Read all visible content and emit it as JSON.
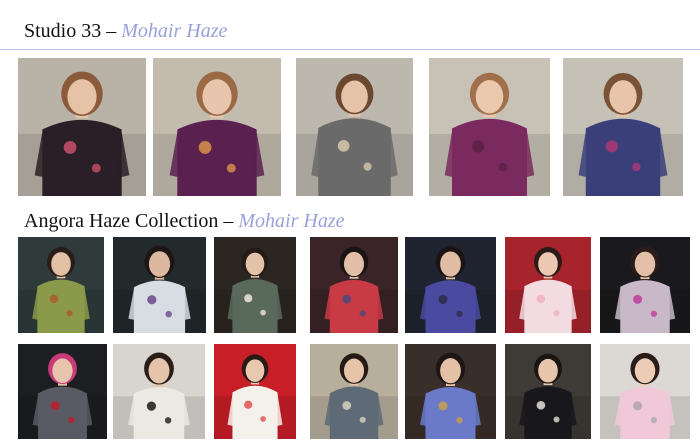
{
  "studio_section": {
    "name": "Studio 33",
    "dash": "–",
    "brand": "Mohair Haze",
    "photos": [
      {
        "bg": "#b9b2a6",
        "garment": "#2a1f26",
        "accent": "#c8506a",
        "skin": "#e6c2a6",
        "hair": "#8a5a3a",
        "icon": "model-photo"
      },
      {
        "bg": "#c3bcae",
        "garment": "#5a2050",
        "accent": "#d9934a",
        "skin": "#e8c6ae",
        "hair": "#9a6a44",
        "icon": "model-photo"
      },
      {
        "bg": "#bdb8ae",
        "garment": "#6b6a6a",
        "accent": "#d7c7ac",
        "skin": "#e6c3a8",
        "hair": "#6c4830",
        "icon": "model-photo"
      },
      {
        "bg": "#c8c2b6",
        "garment": "#7a2a5e",
        "accent": "#5a2044",
        "skin": "#eac8ae",
        "hair": "#a0704a",
        "icon": "model-photo"
      },
      {
        "bg": "#c6c1b7",
        "garment": "#3a3f7a",
        "accent": "#b03878",
        "skin": "#e8c4aa",
        "hair": "#7a5236",
        "icon": "model-photo"
      }
    ]
  },
  "angora_section": {
    "name": "Angora Haze Collection",
    "dash": "–",
    "brand": "Mohair Haze",
    "photos_row1": [
      {
        "bg": "#2e3b3a",
        "garment": "#8a9a4a",
        "accent": "#a85a30",
        "skin": "#e2c0a6",
        "hair": "#2a1c18",
        "icon": "model-photo"
      },
      {
        "bg": "#222a2c",
        "garment": "#d8dde4",
        "accent": "#6a4a8a",
        "skin": "#dcb8a0",
        "hair": "#1e1614",
        "icon": "model-photo"
      },
      {
        "bg": "#2c2622",
        "garment": "#5a6a5a",
        "accent": "#efe6da",
        "skin": "#e4c2a8",
        "hair": "#241a16",
        "icon": "model-photo"
      },
      {
        "bg": "#3a2428",
        "garment": "#c83a44",
        "accent": "#4a4a7a",
        "skin": "#e2bea6",
        "hair": "#1a1414",
        "icon": "model-photo"
      },
      {
        "bg": "#1f2430",
        "garment": "#4a4aa0",
        "accent": "#2c2c4a",
        "skin": "#e0bca4",
        "hair": "#1c1414",
        "icon": "model-photo"
      },
      {
        "bg": "#a8242c",
        "garment": "#f2dce2",
        "accent": "#f0b0c0",
        "skin": "#ecc8b2",
        "hair": "#2a1a18",
        "icon": "model-photo"
      },
      {
        "bg": "#1a1a1e",
        "garment": "#c8b8c8",
        "accent": "#c03a9a",
        "skin": "#e4c0a8",
        "hair": "#2a1c18",
        "icon": "model-photo"
      }
    ],
    "photos_row2": [
      {
        "bg": "#1c1e22",
        "garment": "#5a5a64",
        "accent": "#c01c2c",
        "skin": "#e8c4ac",
        "hair": "#c83a78",
        "icon": "model-photo"
      },
      {
        "bg": "#d8d4ce",
        "garment": "#ece8e2",
        "accent": "#1a1a1a",
        "skin": "#e6c4ac",
        "hair": "#2a1c18",
        "icon": "model-photo"
      },
      {
        "bg": "#c81e28",
        "garment": "#f4f0ea",
        "accent": "#e05050",
        "skin": "#eac8b0",
        "hair": "#2a1a16",
        "icon": "model-photo"
      },
      {
        "bg": "#b7ae9c",
        "garment": "#5e6a76",
        "accent": "#d8cfbf",
        "skin": "#e6c4aa",
        "hair": "#241a16",
        "icon": "model-photo"
      },
      {
        "bg": "#3a2e2a",
        "garment": "#6a7ac8",
        "accent": "#c8a04a",
        "skin": "#e4c0a6",
        "hair": "#1e1614",
        "icon": "model-photo"
      },
      {
        "bg": "#3e3a36",
        "garment": "#18181c",
        "accent": "#e6e0d6",
        "skin": "#e8c6ae",
        "hair": "#1a1412",
        "icon": "model-photo"
      },
      {
        "bg": "#dcd8d4",
        "garment": "#f0c8d8",
        "accent": "#b0a4b0",
        "skin": "#ecccb6",
        "hair": "#2a1c18",
        "icon": "model-photo"
      }
    ]
  }
}
